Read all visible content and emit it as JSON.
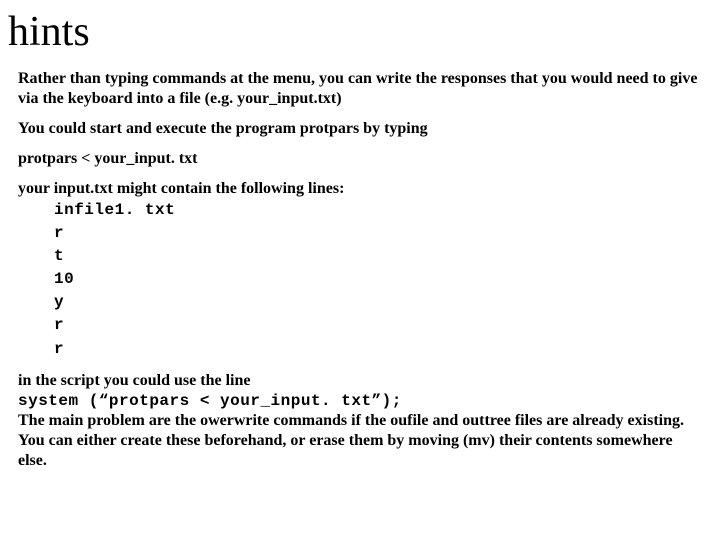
{
  "title": "hints",
  "para1": "Rather than typing commands at the menu, you can write the responses that you would need to give via the keyboard into a file (e.g. your_input.txt)",
  "para2": "You could start and execute the program protpars by typing",
  "para3": "protpars < your_input. txt",
  "para4_intro": "your input.txt  might contain the following lines:",
  "lines": {
    "l1": "infile1. txt",
    "l2": "r",
    "l3": "t",
    "l4": "10",
    "l5": "y",
    "l6": "r",
    "l7": "r"
  },
  "para5a": "in the script you could use the line",
  "para5b": "system (“protpars < your_input. txt”);",
  "para5c": "The main problem are the owerwrite commands if the oufile and outtree files are already existing.  You can either create these beforehand, or erase them by moving (mv) their contents somewhere else."
}
